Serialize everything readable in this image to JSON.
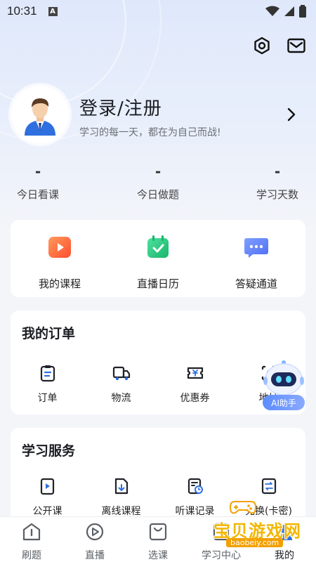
{
  "status_bar": {
    "time": "10:31",
    "notification_icon": "A"
  },
  "header": {
    "settings_icon": "hexagon-settings-icon",
    "message_icon": "mail-icon"
  },
  "profile": {
    "title": "登录/注册",
    "subtitle": "学习的每一天，都在为自己而战!"
  },
  "stats": [
    {
      "value": "-",
      "label": "今日看课"
    },
    {
      "value": "-",
      "label": "今日做题"
    },
    {
      "value": "-",
      "label": "学习天数"
    }
  ],
  "quick_actions": [
    {
      "label": "我的课程",
      "icon": "play-video-icon",
      "color": "#ff6a3d"
    },
    {
      "label": "直播日历",
      "icon": "calendar-check-icon",
      "color": "#22c47a"
    },
    {
      "label": "答疑通道",
      "icon": "chat-bubble-icon",
      "color": "#5b7cff"
    }
  ],
  "orders": {
    "title": "我的订单",
    "items": [
      {
        "label": "订单",
        "icon": "clipboard-icon"
      },
      {
        "label": "物流",
        "icon": "truck-icon"
      },
      {
        "label": "优惠券",
        "icon": "coupon-icon"
      },
      {
        "label": "地址",
        "icon": "address-icon"
      }
    ]
  },
  "ai_helper": {
    "label": "AI助手"
  },
  "services": {
    "title": "学习服务",
    "items": [
      {
        "label": "公开课",
        "icon": "open-course-icon"
      },
      {
        "label": "离线课程",
        "icon": "offline-download-icon"
      },
      {
        "label": "听课记录",
        "icon": "history-record-icon"
      },
      {
        "label": "兑换(卡密)",
        "icon": "exchange-icon"
      }
    ]
  },
  "tabbar": [
    {
      "label": "刷题",
      "icon": "practice-icon"
    },
    {
      "label": "直播",
      "icon": "live-play-icon"
    },
    {
      "label": "选课",
      "icon": "course-bag-icon"
    },
    {
      "label": "学习中心",
      "icon": "study-center-icon"
    },
    {
      "label": "我的",
      "icon": "profile-icon"
    }
  ],
  "watermark": {
    "text": "宝贝游戏网",
    "url": "baobeiy.com"
  },
  "colors": {
    "accent": "#5b8cff",
    "background": "#f3f5f9",
    "card": "#ffffff"
  }
}
